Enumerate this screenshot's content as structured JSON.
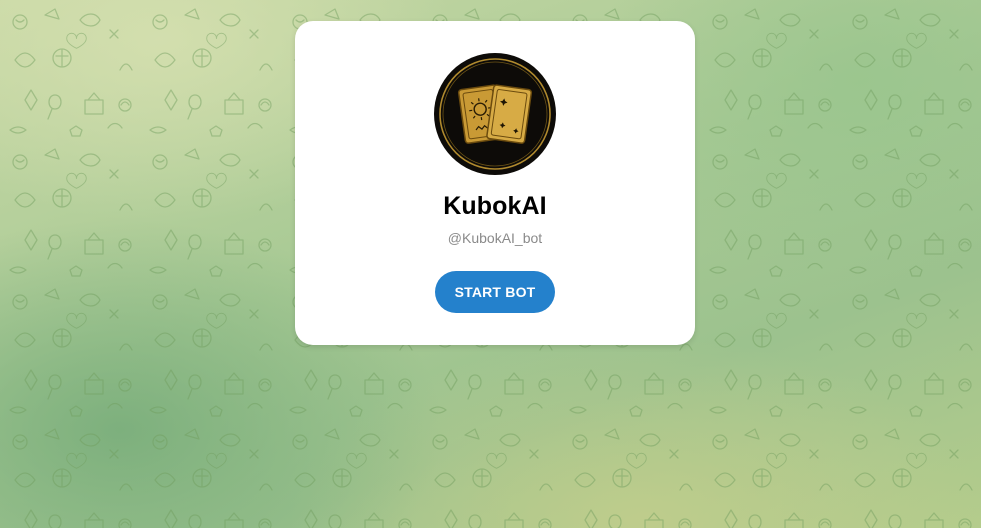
{
  "bot": {
    "name": "KubokAI",
    "username": "@KubokAI_bot",
    "avatar_icon": "tarot-cards-icon"
  },
  "actions": {
    "start_label": "START BOT"
  },
  "theme": {
    "accent": "#2481cc",
    "card_background": "#ffffff",
    "username_color": "#8a8a8a",
    "background_pattern": "telegram-doodle-pattern"
  }
}
